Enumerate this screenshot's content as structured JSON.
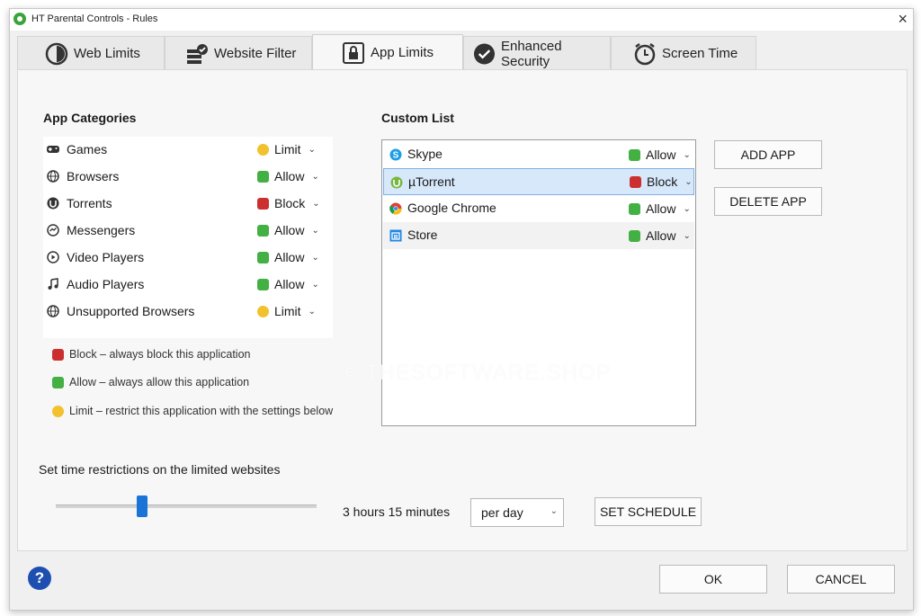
{
  "window": {
    "title": "HT Parental Controls - Rules",
    "close_label": "×"
  },
  "tabs": [
    {
      "label": "Web Limits",
      "icon": "clock-half-icon"
    },
    {
      "label": "Website Filter",
      "icon": "firewall-check-icon"
    },
    {
      "label": "App Limits",
      "icon": "app-lock-icon",
      "active": true
    },
    {
      "label": "Enhanced Security",
      "icon": "shield-check-icon"
    },
    {
      "label": "Screen Time",
      "icon": "alarm-clock-icon"
    }
  ],
  "app_categories": {
    "title": "App Categories",
    "items": [
      {
        "label": "Games",
        "icon": "gamepad-icon",
        "status": "Limit"
      },
      {
        "label": "Browsers",
        "icon": "globe-icon",
        "status": "Allow"
      },
      {
        "label": "Torrents",
        "icon": "torrent-icon",
        "status": "Block"
      },
      {
        "label": "Messengers",
        "icon": "messenger-icon",
        "status": "Allow"
      },
      {
        "label": "Video Players",
        "icon": "play-circle-icon",
        "status": "Allow"
      },
      {
        "label": "Audio Players",
        "icon": "music-note-icon",
        "status": "Allow"
      },
      {
        "label": "Unsupported Browsers",
        "icon": "globe-icon",
        "status": "Limit"
      }
    ]
  },
  "legend": [
    {
      "text": "Block – always block this application",
      "type": "block"
    },
    {
      "text": "Allow – always allow this application",
      "type": "allow"
    },
    {
      "text": "Limit – restrict this application with the settings below",
      "type": "limit"
    }
  ],
  "custom_list": {
    "title": "Custom List",
    "items": [
      {
        "label": "Skype",
        "icon": "skype-icon",
        "status": "Allow"
      },
      {
        "label": "µTorrent",
        "icon": "utorrent-icon",
        "status": "Block",
        "selected": true
      },
      {
        "label": "Google Chrome",
        "icon": "chrome-icon",
        "status": "Allow"
      },
      {
        "label": "Store",
        "icon": "store-icon",
        "status": "Allow"
      }
    ]
  },
  "buttons": {
    "add_app": "ADD APP",
    "delete_app": "DELETE APP",
    "set_schedule": "SET SCHEDULE",
    "ok": "OK",
    "cancel": "CANCEL",
    "help": "?"
  },
  "time_restriction": {
    "label": "Set time restrictions on the limited websites",
    "value_text": "3 hours 15 minutes",
    "slider_fraction": 0.33,
    "period": "per day"
  },
  "watermark": "© THESOFTWARE.SHOP",
  "colors": {
    "allow": "#43b043",
    "block": "#cc2f2f",
    "limit": "#f2c12e",
    "accent": "#1a73d6",
    "selection": "#d7e8fb",
    "help_button": "#1e4fb0"
  }
}
